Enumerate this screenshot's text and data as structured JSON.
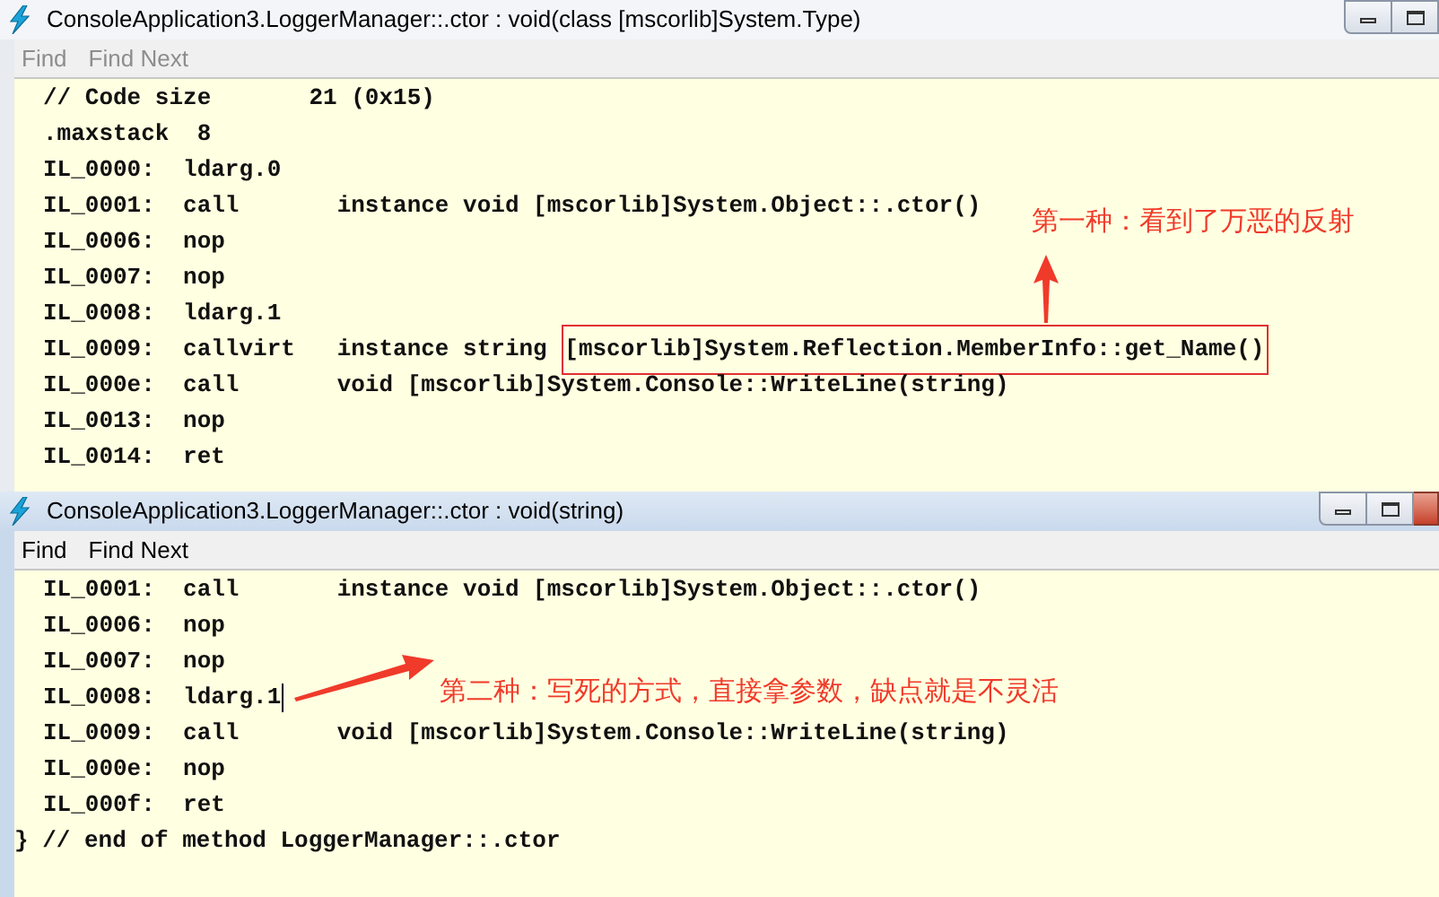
{
  "windows": [
    {
      "title": "ConsoleApplication3.LoggerManager::.ctor : void(class [mscorlib]System.Type)",
      "active": false,
      "menu": [
        {
          "label": "Find",
          "disabled": true
        },
        {
          "label": "Find Next",
          "disabled": true
        }
      ],
      "lines": [
        {
          "text": "// Code size       21 (0x15)"
        },
        {
          "text": ".maxstack  8"
        },
        {
          "text": "IL_0000:  ldarg.0"
        },
        {
          "text": "IL_0001:  call       instance void [mscorlib]System.Object::.ctor()"
        },
        {
          "text": "IL_0006:  nop"
        },
        {
          "text": "IL_0007:  nop"
        },
        {
          "text": "IL_0008:  ldarg.1"
        },
        {
          "text": "IL_0009:  callvirt   instance string ",
          "boxed": "[mscorlib]System.Reflection.MemberInfo::get_Name()"
        },
        {
          "text": "IL_000e:  call       void [mscorlib]System.Console::WriteLine(string)"
        },
        {
          "text": "IL_0013:  nop"
        },
        {
          "text": "IL_0014:  ret"
        }
      ],
      "annotation": {
        "text": "第一种：看到了万恶的反射",
        "kind": "up"
      }
    },
    {
      "title": "ConsoleApplication3.LoggerManager::.ctor : void(string)",
      "active": true,
      "menu": [
        {
          "label": "Find",
          "disabled": false
        },
        {
          "label": "Find Next",
          "disabled": false
        }
      ],
      "lines": [
        {
          "text": "IL_0001:  call       instance void [mscorlib]System.Object::.ctor()"
        },
        {
          "text": "IL_0006:  nop"
        },
        {
          "text": "IL_0007:  nop"
        },
        {
          "text": "IL_0008:  ldarg.1",
          "cursor": true
        },
        {
          "text": "IL_0009:  call       void [mscorlib]System.Console::WriteLine(string)"
        },
        {
          "text": "IL_000e:  nop"
        },
        {
          "text": "IL_000f:  ret"
        },
        {
          "text": "} // end of method LoggerManager::.ctor",
          "outdent": true
        }
      ],
      "annotation": {
        "text": "第二种：写死的方式，直接拿参数，缺点就是不灵活",
        "kind": "left"
      }
    }
  ]
}
